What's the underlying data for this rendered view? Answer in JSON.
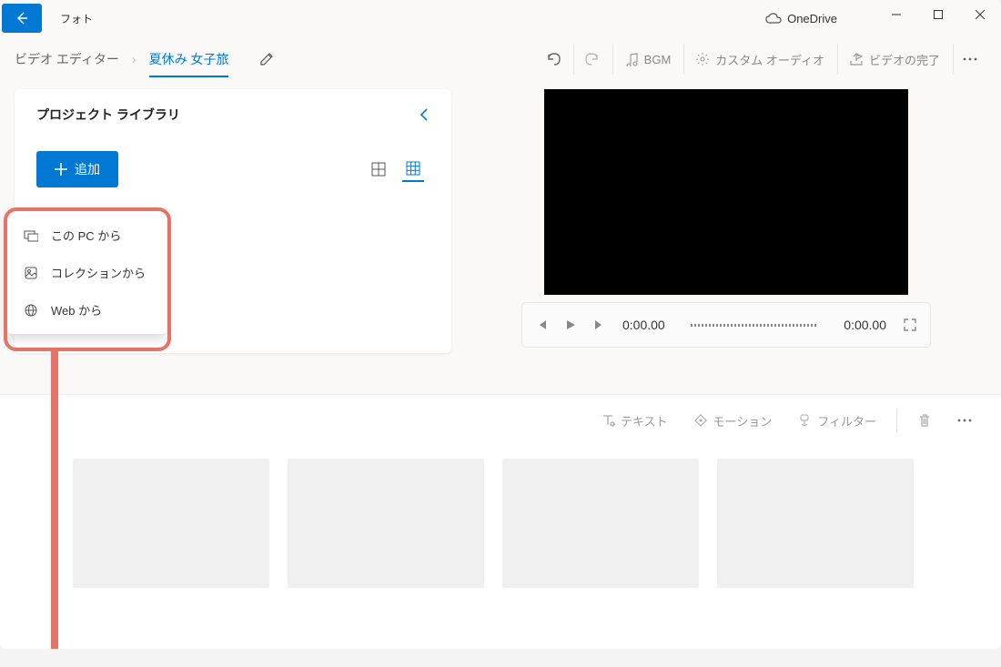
{
  "titlebar": {
    "app_title": "フォト",
    "onedrive_label": "OneDrive"
  },
  "toolbar": {
    "breadcrumb_root": "ビデオ エディター",
    "project_name": "夏休み 女子旅",
    "undo": "",
    "redo": "",
    "bgm": "BGM",
    "custom_audio": "カスタム オーディオ",
    "finish_video": "ビデオの完了"
  },
  "library": {
    "title": "プロジェクト ライブラリ",
    "add_label": "追加",
    "menu": {
      "from_pc": "この PC から",
      "from_collection": "コレクションから",
      "from_web": "Web から"
    }
  },
  "playback": {
    "current_time": "0:00.00",
    "total_time": "0:00.00"
  },
  "storyboard": {
    "text": "テキスト",
    "motion": "モーション",
    "filter": "フィルター"
  }
}
